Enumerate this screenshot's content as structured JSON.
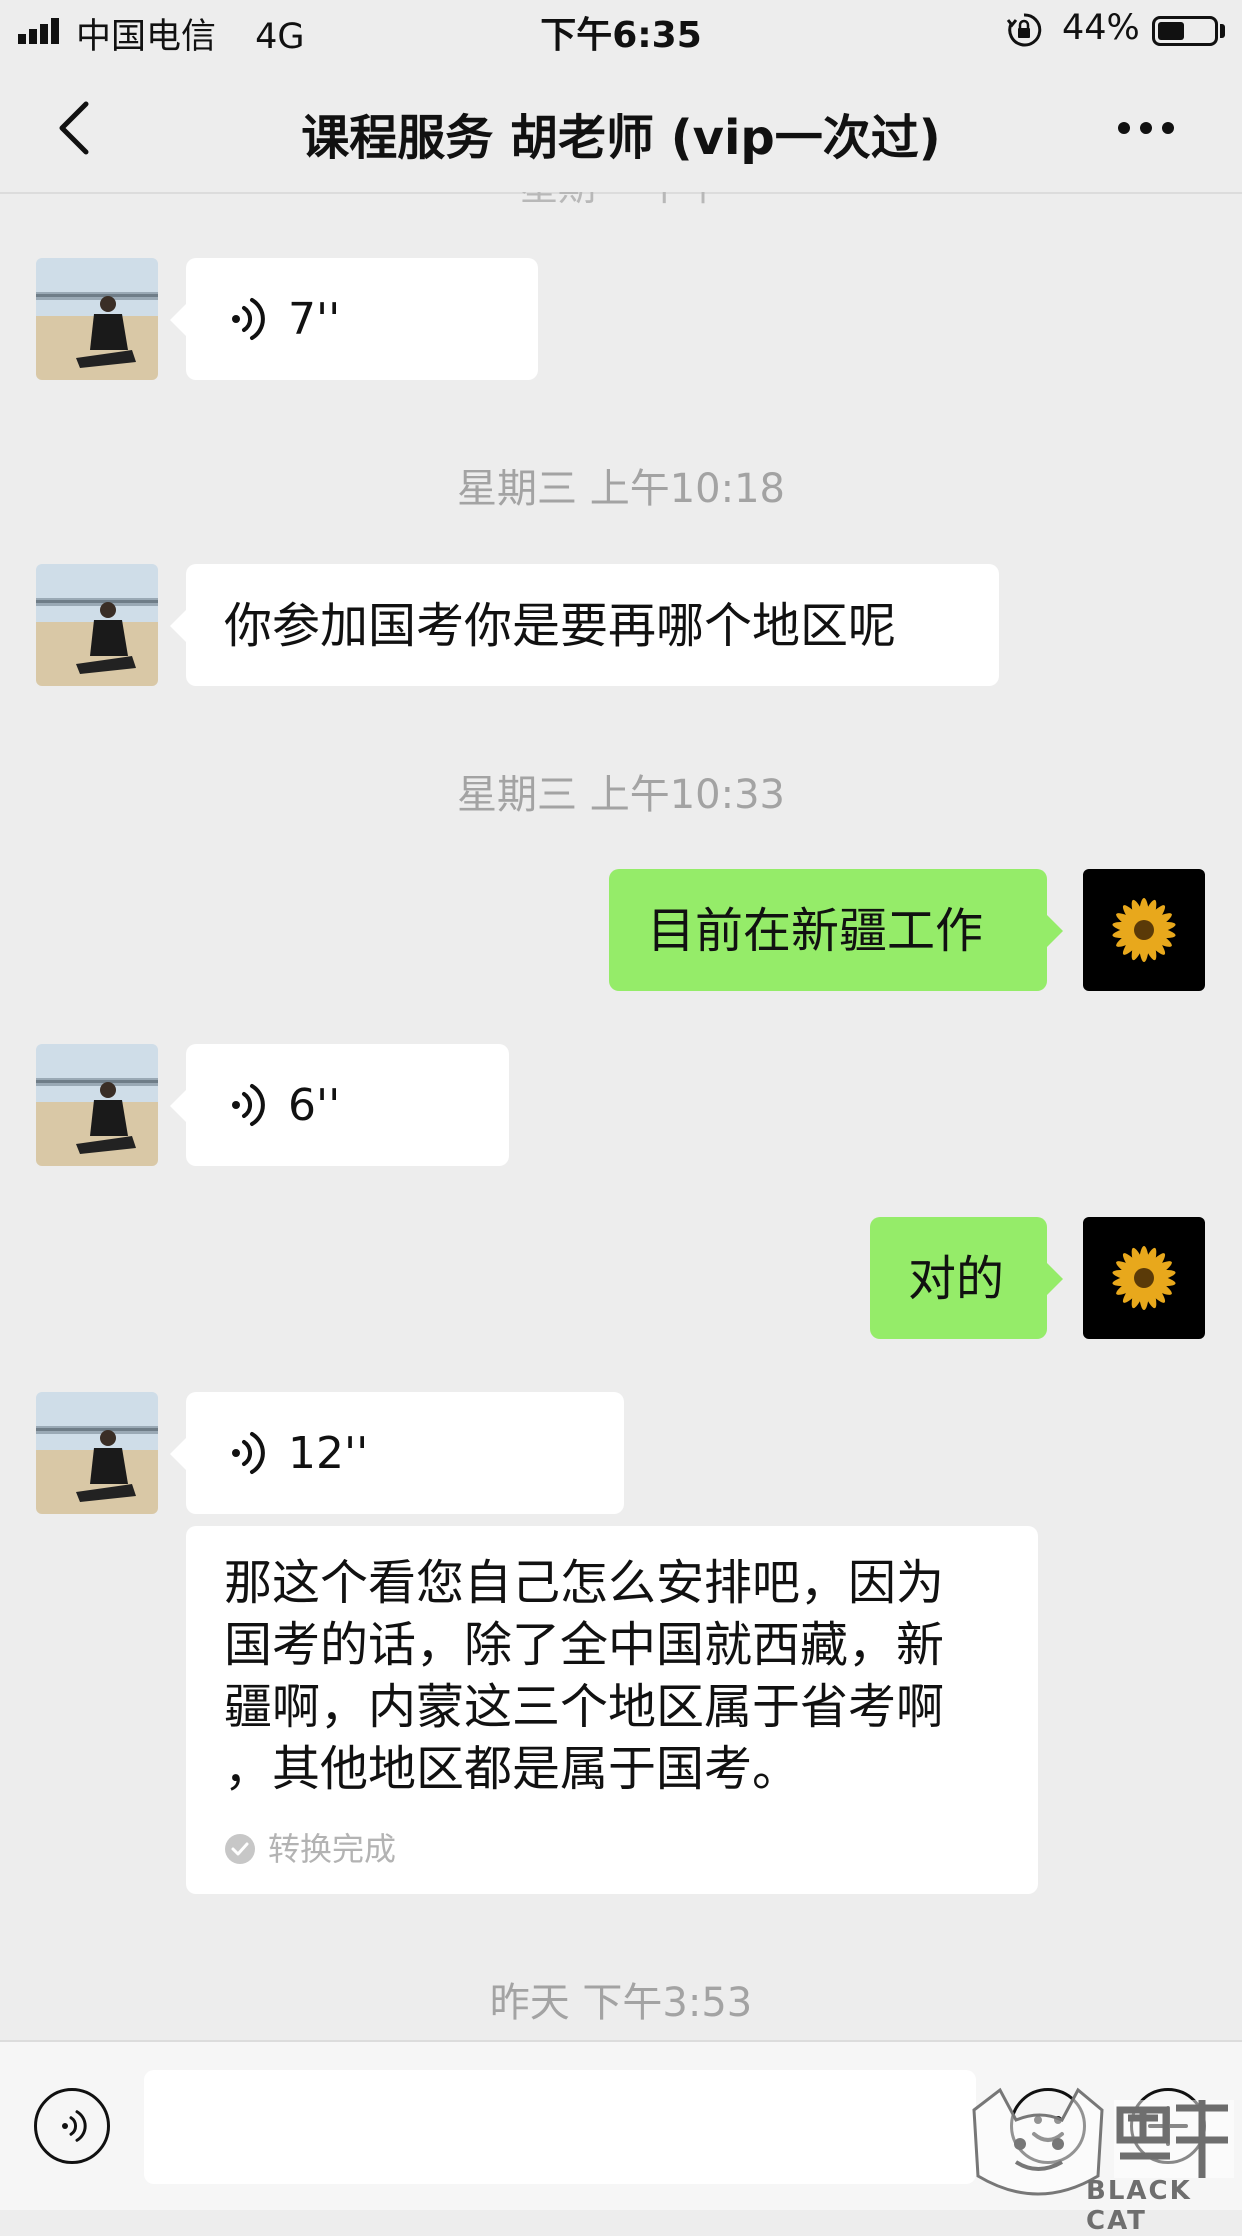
{
  "status_bar": {
    "carrier": "中国电信",
    "network": "4G",
    "time": "下午6:35",
    "battery": "44%",
    "battery_level": 0.44
  },
  "header": {
    "title": "课程服务 胡老师 (vip一次过)",
    "ghost_timestamp": "星期一 下午"
  },
  "messages": [
    {
      "type": "voice",
      "side": "left",
      "duration": "7''"
    },
    {
      "type": "timestamp",
      "text": "星期三 上午10:18"
    },
    {
      "type": "text",
      "side": "left",
      "text": "你参加国考你是要再哪个地区呢"
    },
    {
      "type": "timestamp",
      "text": "星期三 上午10:33"
    },
    {
      "type": "text",
      "side": "right",
      "text": "目前在新疆工作"
    },
    {
      "type": "voice",
      "side": "left",
      "duration": "6''"
    },
    {
      "type": "text",
      "side": "right",
      "text": "对的"
    },
    {
      "type": "voice",
      "side": "left",
      "duration": "12''"
    },
    {
      "type": "transcription",
      "lines": [
        "那这个看您自己怎么安排吧，因为",
        "国考的话，除了全中国就西藏，新",
        "疆啊，内蒙这三个地区属于省考啊",
        "，其他地区都是属于国考。"
      ],
      "status": "转换完成"
    },
    {
      "type": "timestamp",
      "text": "昨天 下午3:53"
    }
  ],
  "watermark": {
    "text": "BLACK CAT"
  }
}
